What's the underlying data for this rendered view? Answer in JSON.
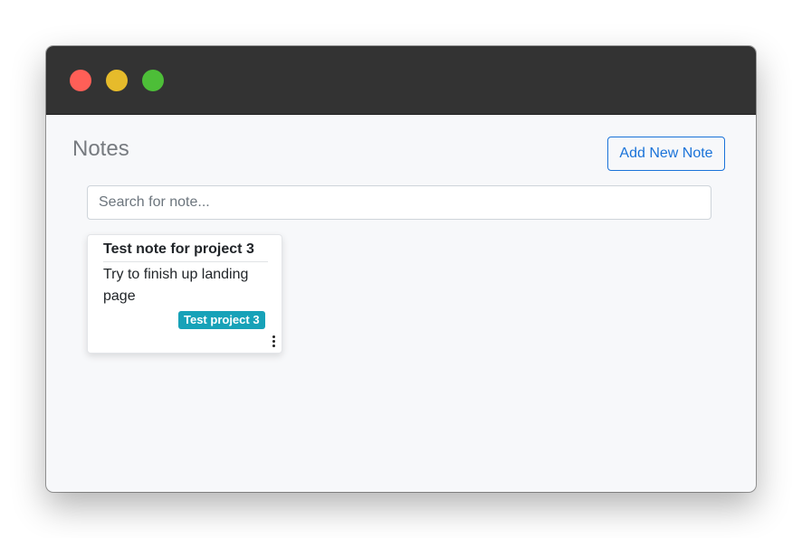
{
  "window": {
    "controls": [
      {
        "name": "close",
        "color": "#ff5f57"
      },
      {
        "name": "minimize",
        "color": "#e6bb2b"
      },
      {
        "name": "maximize",
        "color": "#4dbe38"
      }
    ]
  },
  "header": {
    "title": "Notes",
    "add_button_label": "Add New Note"
  },
  "search": {
    "placeholder": "Search for note...",
    "value": ""
  },
  "notes": [
    {
      "title": "Test note for project 3",
      "body": "Try to finish up landing page",
      "tag": "Test project 3",
      "tag_color": "#17a2b8",
      "menu_icon": "kebab-menu-icon"
    }
  ],
  "colors": {
    "accent": "#1a73d9",
    "titlebar": "#333333",
    "background": "#f7f8fa"
  }
}
